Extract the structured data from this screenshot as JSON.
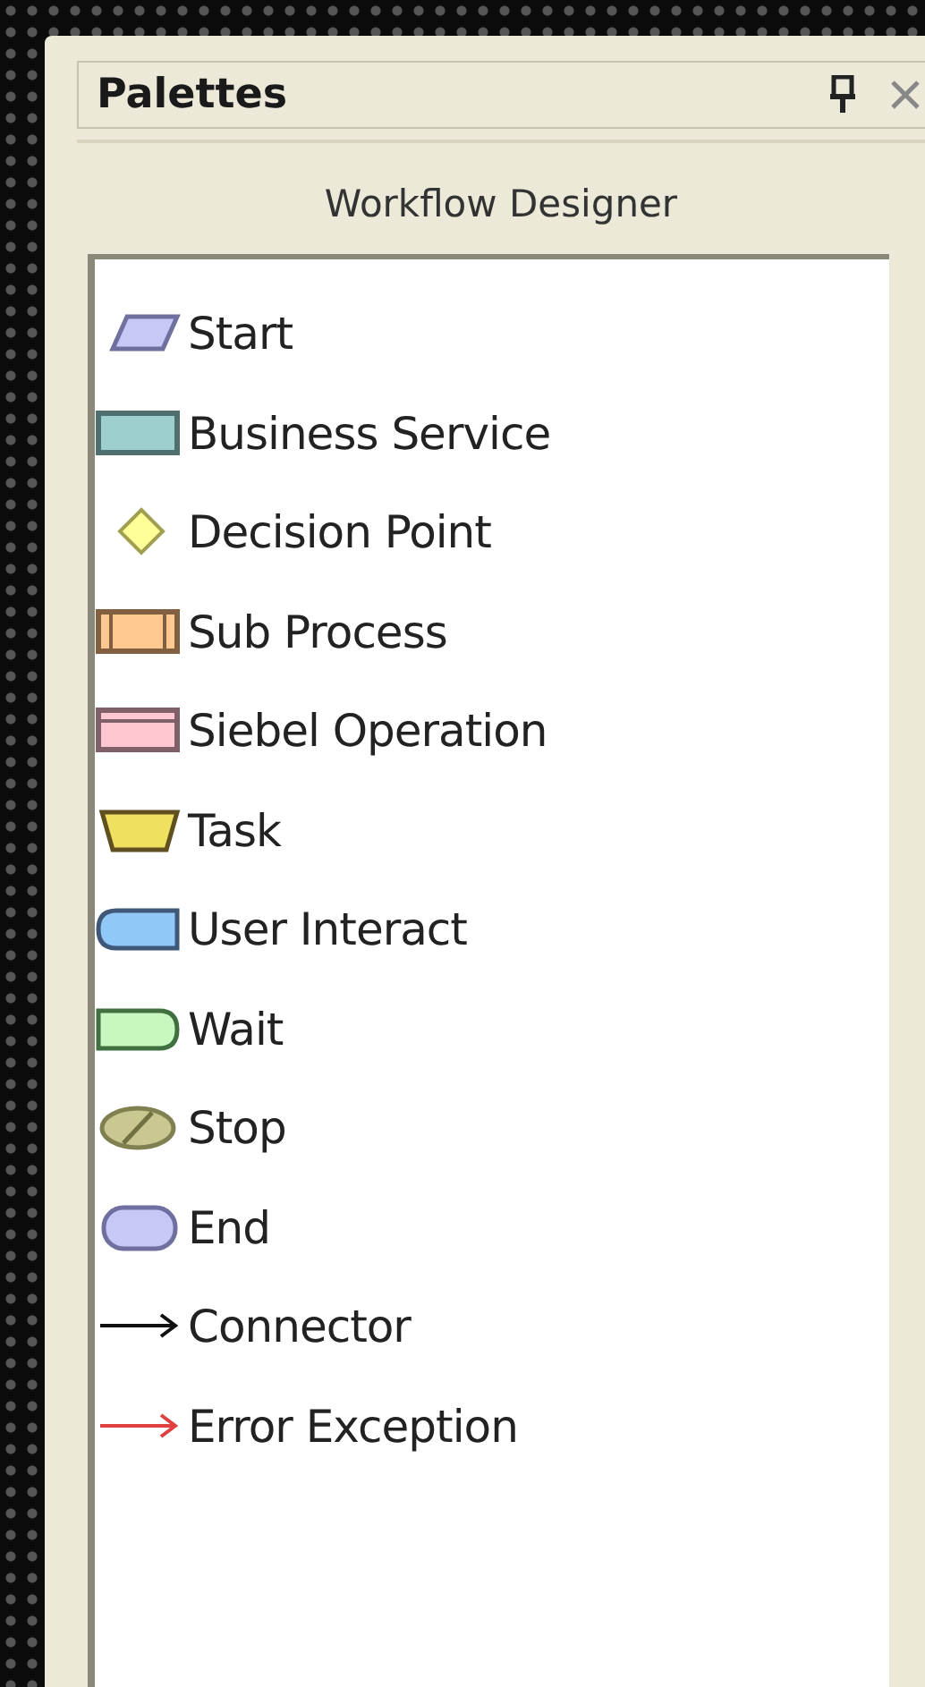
{
  "panel": {
    "title": "Palettes",
    "subtitle": "Workflow Designer"
  },
  "items": [
    {
      "kind": "start",
      "label": "Start"
    },
    {
      "kind": "service",
      "label": "Business Service"
    },
    {
      "kind": "decision",
      "label": "Decision Point"
    },
    {
      "kind": "subprocess",
      "label": "Sub Process"
    },
    {
      "kind": "operation",
      "label": "Siebel Operation"
    },
    {
      "kind": "task",
      "label": "Task"
    },
    {
      "kind": "interact",
      "label": "User Interact"
    },
    {
      "kind": "wait",
      "label": "Wait"
    },
    {
      "kind": "stop",
      "label": "Stop"
    },
    {
      "kind": "end",
      "label": "End"
    },
    {
      "kind": "connector",
      "label": "Connector"
    },
    {
      "kind": "error",
      "label": "Error Exception"
    }
  ]
}
